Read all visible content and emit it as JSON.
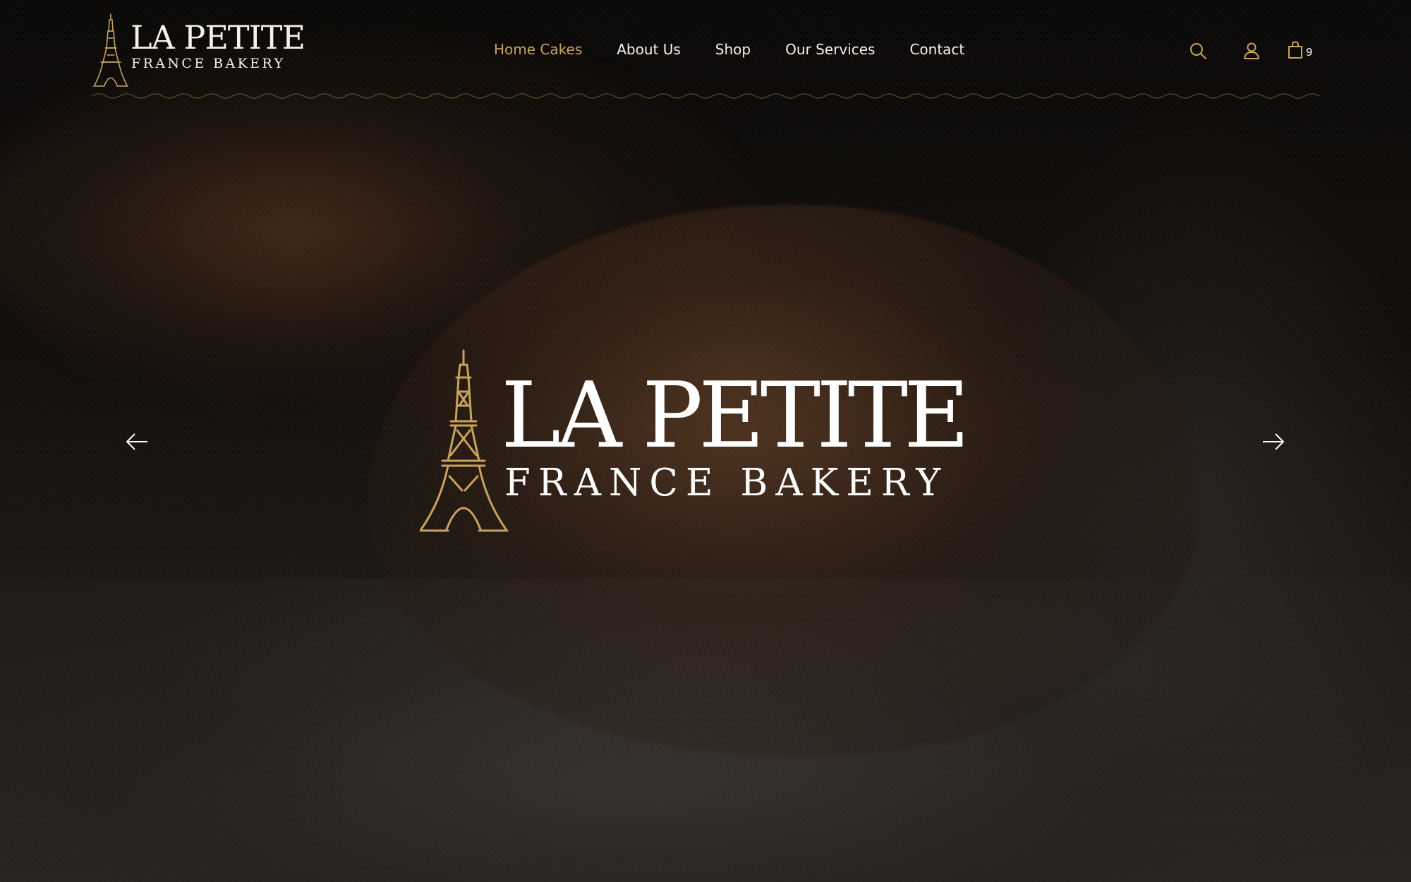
{
  "brand": {
    "line1": "LA PETITE",
    "line2": "FRANCE BAKERY"
  },
  "nav": {
    "items": [
      {
        "label": "Home Cakes",
        "active": true
      },
      {
        "label": "About Us",
        "active": false
      },
      {
        "label": "Shop",
        "active": false
      },
      {
        "label": "Our Services",
        "active": false
      },
      {
        "label": "Contact",
        "active": false
      }
    ]
  },
  "header_icons": {
    "search": "search-icon",
    "account": "user-icon",
    "cart": "shopping-bag-icon",
    "cart_count": "9"
  },
  "hero": {
    "logo_line1": "LA PETITE",
    "logo_line2": "FRANCE BAKERY",
    "prev_icon": "arrow-left-icon",
    "next_icon": "arrow-right-icon"
  },
  "colors": {
    "accent_gold": "#c9a35d",
    "text_light": "#f5f3ef",
    "background_dark": "#0b0907"
  }
}
